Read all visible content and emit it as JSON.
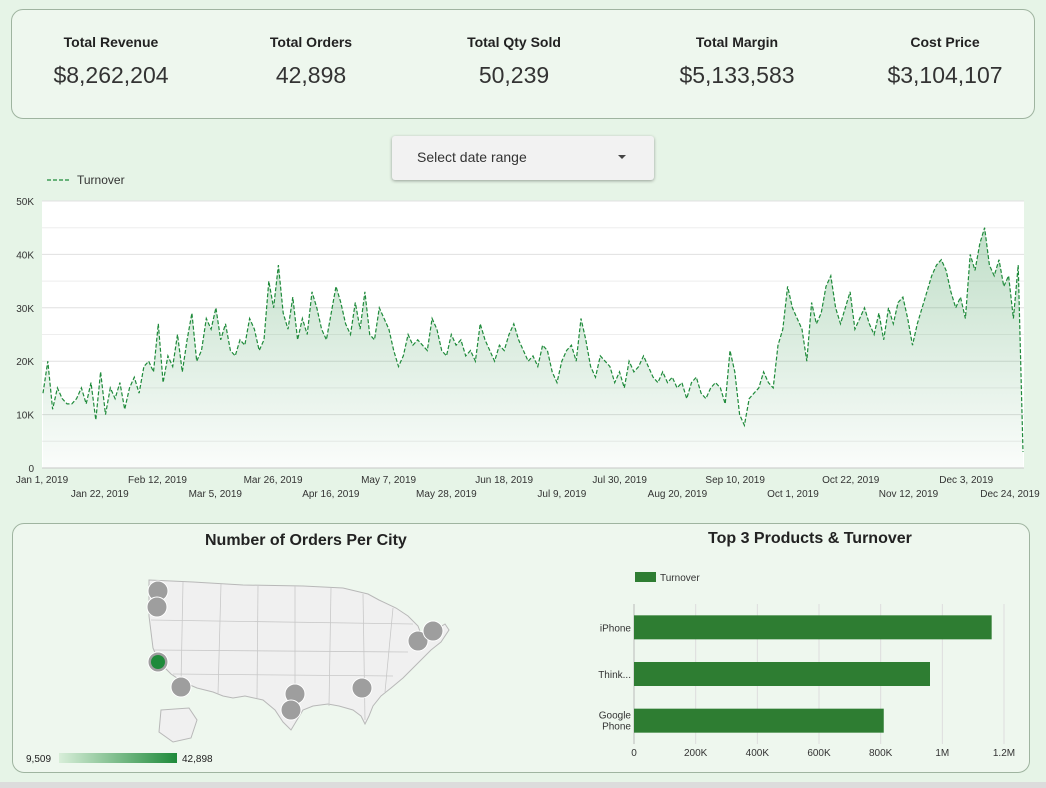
{
  "kpis": [
    {
      "label": "Total Revenue",
      "value": "$8,262,204"
    },
    {
      "label": "Total Orders",
      "value": "42,898"
    },
    {
      "label": "Total Qty Sold",
      "value": "50,239"
    },
    {
      "label": "Total Margin",
      "value": "$5,133,583"
    },
    {
      "label": "Cost Price",
      "value": "$3,104,107"
    }
  ],
  "date_selector": {
    "label": "Select date range"
  },
  "map_panel": {
    "title": "Number of Orders Per City",
    "scale_min": "9,509",
    "scale_max": "42,898",
    "colors": {
      "low": "#d8eed9",
      "high": "#1e8a3a",
      "bubble": "#9e9e9e",
      "highlight": "#1e8a3a"
    }
  },
  "colors": {
    "accent": "#2e7d32",
    "line": "#1e8a3a"
  },
  "chart_data": [
    {
      "type": "line",
      "legend": [
        "Turnover"
      ],
      "legend_position": "top-left",
      "grid": true,
      "ylim": [
        0,
        50000
      ],
      "y_ticks": [
        "0",
        "10K",
        "20K",
        "30K",
        "40K",
        "50K"
      ],
      "x_ticks_top": [
        "Jan 1, 2019",
        "Feb 12, 2019",
        "Mar 26, 2019",
        "May 7, 2019",
        "Jun 18, 2019",
        "Jul 30, 2019",
        "Sep 10, 2019",
        "Oct 22, 2019",
        "Dec 3, 2019"
      ],
      "x_ticks_bottom": [
        "Jan 22, 2019",
        "Mar 5, 2019",
        "Apr 16, 2019",
        "May 28, 2019",
        "Jul 9, 2019",
        "Aug 20, 2019",
        "Oct 1, 2019",
        "Nov 12, 2019",
        "Dec 24, 2019"
      ],
      "series": [
        {
          "name": "Turnover",
          "x_start": "2019-01-01",
          "x_end": "2019-12-31",
          "values": [
            14000,
            20000,
            11000,
            15000,
            13000,
            12000,
            12000,
            13000,
            15000,
            12000,
            16000,
            9000,
            18000,
            10000,
            15000,
            13000,
            16000,
            11000,
            15000,
            17000,
            14000,
            19000,
            20000,
            18000,
            27000,
            16000,
            21000,
            19000,
            25000,
            18000,
            24000,
            29000,
            20000,
            22000,
            28000,
            26000,
            30000,
            24000,
            27000,
            22000,
            21000,
            24000,
            23000,
            28000,
            26000,
            22000,
            24000,
            35000,
            30000,
            38000,
            29000,
            26000,
            32000,
            24000,
            28000,
            25000,
            33000,
            30000,
            26000,
            24000,
            29000,
            34000,
            31000,
            27000,
            25000,
            31000,
            26000,
            33000,
            25000,
            24000,
            30000,
            28000,
            26000,
            22000,
            19000,
            21000,
            25000,
            23000,
            24000,
            23000,
            22000,
            28000,
            26000,
            22000,
            21000,
            25000,
            23000,
            24000,
            21000,
            22000,
            20000,
            27000,
            24000,
            22000,
            20000,
            23000,
            22000,
            25000,
            27000,
            24000,
            22000,
            20000,
            21000,
            19000,
            23000,
            22000,
            18000,
            16000,
            20000,
            22000,
            23000,
            20000,
            28000,
            24000,
            19000,
            17000,
            21000,
            20000,
            19000,
            16000,
            18000,
            15000,
            20000,
            18000,
            19000,
            21000,
            19000,
            17000,
            16000,
            18000,
            16000,
            17000,
            15000,
            16000,
            13000,
            16000,
            17000,
            14000,
            13000,
            15000,
            16000,
            15000,
            12000,
            22000,
            18000,
            10000,
            8000,
            13000,
            14000,
            15000,
            18000,
            16000,
            15000,
            23000,
            26000,
            34000,
            30000,
            28000,
            26000,
            20000,
            31000,
            27000,
            29000,
            34000,
            36000,
            30000,
            27000,
            30000,
            33000,
            26000,
            28000,
            30000,
            27000,
            25000,
            29000,
            24000,
            30000,
            27000,
            31000,
            32000,
            28000,
            23000,
            27000,
            30000,
            33000,
            36000,
            38000,
            39000,
            37000,
            33000,
            30000,
            32000,
            28000,
            40000,
            37000,
            42000,
            45000,
            38000,
            36000,
            39000,
            34000,
            36000,
            28000,
            38000,
            3000
          ]
        }
      ]
    },
    {
      "type": "bar",
      "orientation": "horizontal",
      "title": "Top 3 Products & Turnover",
      "legend": [
        "Turnover"
      ],
      "legend_position": "top-left",
      "categories": [
        "iPhone",
        "Think...",
        "Google Phone"
      ],
      "values": [
        1160000,
        960000,
        810000
      ],
      "xlim": [
        0,
        1200000
      ],
      "x_ticks": [
        "0",
        "200K",
        "400K",
        "600K",
        "800K",
        "1M",
        "1.2M"
      ]
    }
  ]
}
